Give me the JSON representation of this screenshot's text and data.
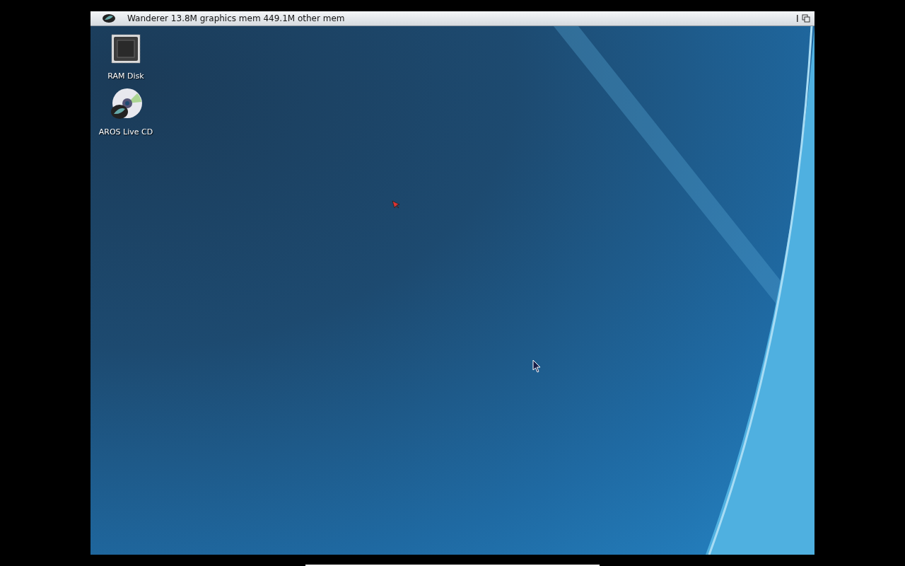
{
  "screen": {
    "title": "Wanderer 13.8M graphics mem 449.1M other mem"
  },
  "desktop_icons": [
    {
      "label": "RAM Disk",
      "kind": "chip"
    },
    {
      "label": "AROS Live CD",
      "kind": "cd"
    }
  ]
}
